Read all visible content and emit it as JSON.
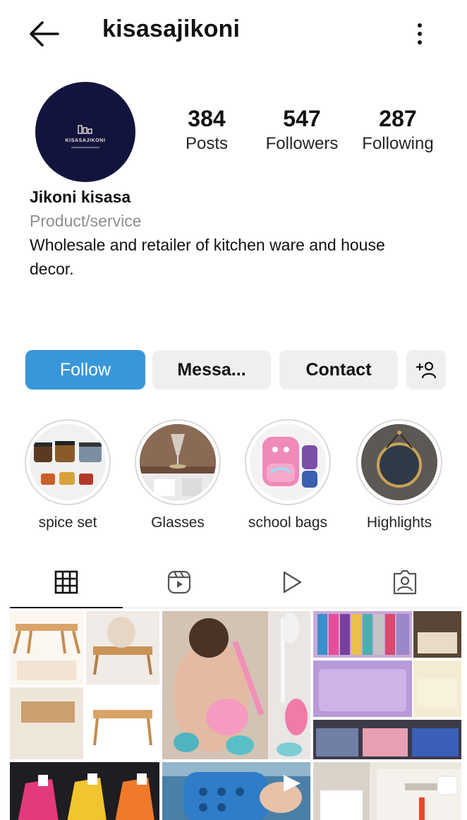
{
  "header": {
    "username": "kisasajikoni",
    "back_icon": "arrow-left-icon",
    "more_icon": "more-vertical-icon"
  },
  "profile": {
    "avatar": {
      "logo_text": "KISASAJIKONI",
      "background": "#13143e"
    },
    "stats": {
      "posts": {
        "value": "384",
        "label": "Posts"
      },
      "followers": {
        "value": "547",
        "label": "Followers"
      },
      "following": {
        "value": "287",
        "label": "Following"
      }
    },
    "name": "Jikoni kisasa",
    "category": "Product/service",
    "bio": "Wholesale and retailer of kitchen ware and house decor."
  },
  "actions": {
    "follow": "Follow",
    "message": "Messa...",
    "contact": "Contact",
    "add_icon": "add-person-icon",
    "accent": "#3897d8"
  },
  "highlights": [
    {
      "label": "spice set"
    },
    {
      "label": "Glasses"
    },
    {
      "label": "school bags"
    },
    {
      "label": "Highlights"
    }
  ],
  "tabs": [
    {
      "icon": "grid-icon",
      "active": true
    },
    {
      "icon": "reels-icon",
      "active": false
    },
    {
      "icon": "play-icon",
      "active": false
    },
    {
      "icon": "tagged-icon",
      "active": false
    }
  ]
}
